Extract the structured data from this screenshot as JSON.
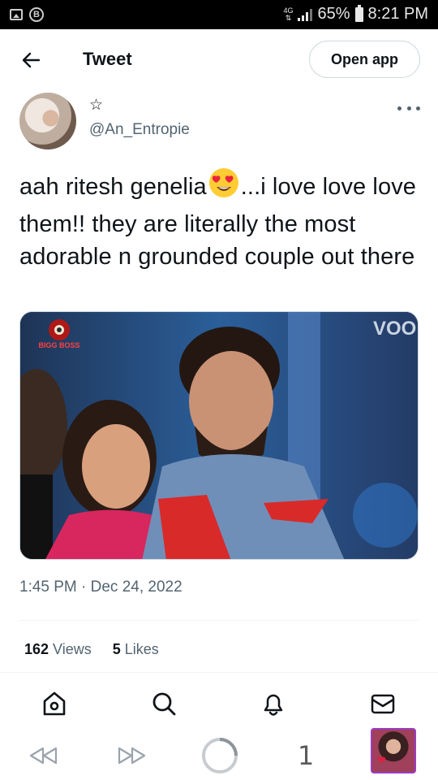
{
  "status_bar": {
    "network": "4G",
    "battery": "65%",
    "time": "8:21 PM"
  },
  "header": {
    "title": "Tweet",
    "open_app_label": "Open app"
  },
  "author": {
    "display_icon": "star-outline-icon",
    "handle": "@An_Entropie"
  },
  "tweet": {
    "text_part1": "aah ritesh genelia",
    "emoji": "heart-eyes-emoji",
    "text_part2": "...i love love love them!! they are literally the most adorable n grounded couple out there",
    "media_watermark": "VOO",
    "media_logo": "BIGG BOSS",
    "timestamp": "1:45 PM · Dec 24, 2022"
  },
  "stats": {
    "views_count": "162",
    "views_label": "Views",
    "likes_count": "5",
    "likes_label": "Likes"
  },
  "bottom_nav": [
    "home-icon",
    "search-icon",
    "notifications-bell-icon",
    "messages-mail-icon"
  ],
  "system_nav": {
    "page_number": "1"
  },
  "colors": {
    "text_primary": "#0f1419",
    "text_secondary": "#536471",
    "border": "#cfd9de",
    "thumbnail_border": "#9b3cc4"
  }
}
